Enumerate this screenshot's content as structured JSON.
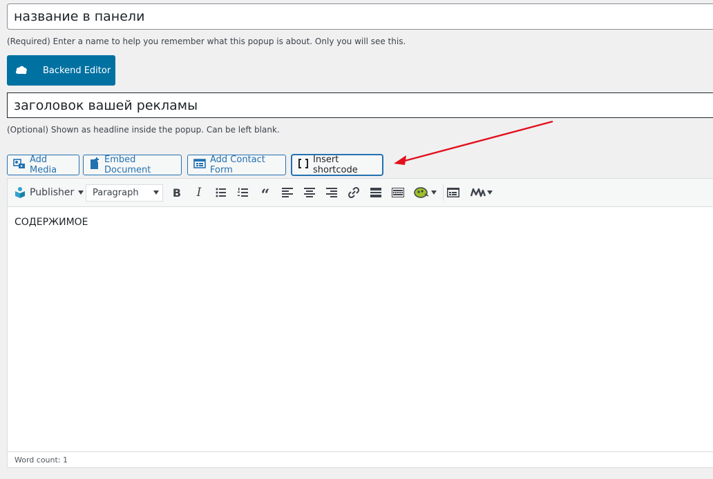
{
  "name_field": {
    "value": "название в панели",
    "help": "(Required) Enter a name to help you remember what this popup is about. Only you will see this."
  },
  "backend_editor": {
    "label": "Backend Editor"
  },
  "headline_field": {
    "value": "заголовок вашей рекламы",
    "help": "(Optional) Shown as headline inside the popup. Can be left blank."
  },
  "media_buttons": {
    "add_media": "Add Media",
    "embed_document": "Embed Document",
    "add_contact_form": "Add Contact Form",
    "insert_shortcode": "Insert shortcode"
  },
  "toolbar": {
    "publisher": "Publisher",
    "format_select": "Paragraph",
    "buttons": [
      "bold-icon",
      "italic-icon",
      "bullet-list-icon",
      "numbered-list-icon",
      "blockquote-icon",
      "align-left-icon",
      "align-center-icon",
      "align-right-icon",
      "link-icon",
      "read-more-icon",
      "keyboard-icon",
      "plugin-icon",
      "form-icon",
      "m-logo-icon"
    ]
  },
  "editor": {
    "content": "СОДЕРЖИМОЕ",
    "word_count": "Word count: 1"
  },
  "colors": {
    "primary": "#0071a1",
    "link": "#2271b1",
    "arrow": "#e2101c"
  }
}
